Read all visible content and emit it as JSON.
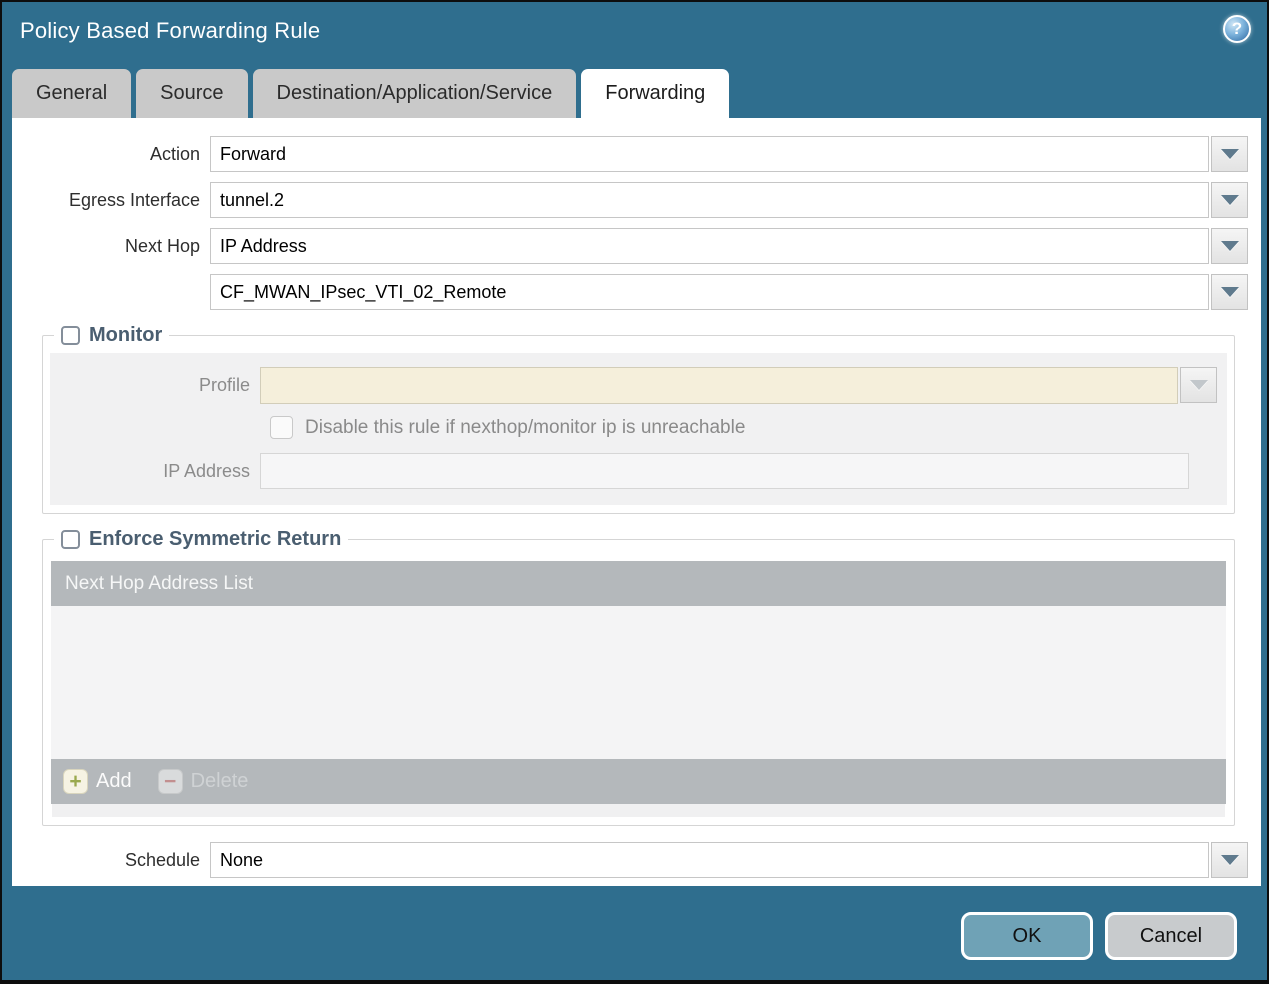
{
  "dialog": {
    "title": "Policy Based Forwarding Rule"
  },
  "tabs": [
    {
      "label": "General",
      "active": false
    },
    {
      "label": "Source",
      "active": false
    },
    {
      "label": "Destination/Application/Service",
      "active": false
    },
    {
      "label": "Forwarding",
      "active": true
    }
  ],
  "form": {
    "action": {
      "label": "Action",
      "value": "Forward"
    },
    "egress_interface": {
      "label": "Egress Interface",
      "value": "tunnel.2"
    },
    "next_hop": {
      "label": "Next Hop",
      "value": "IP Address"
    },
    "next_hop_address": {
      "value": "CF_MWAN_IPsec_VTI_02_Remote"
    },
    "schedule": {
      "label": "Schedule",
      "value": "None"
    }
  },
  "monitor": {
    "legend": "Monitor",
    "checked": false,
    "profile": {
      "label": "Profile",
      "value": ""
    },
    "disable_rule": {
      "label": "Disable this rule if nexthop/monitor ip is unreachable",
      "checked": false
    },
    "ip_address": {
      "label": "IP Address",
      "value": ""
    }
  },
  "enforce_symmetric_return": {
    "legend": "Enforce Symmetric Return",
    "checked": false,
    "table_header": "Next Hop Address List",
    "rows": [],
    "add_label": "Add",
    "delete_label": "Delete"
  },
  "footer": {
    "ok_label": "OK",
    "cancel_label": "Cancel"
  },
  "colors": {
    "titlebar": "#2f6e8e",
    "ok_button": "#6fa2b6",
    "cancel_button": "#c8cbcd",
    "table_chrome": "#b4b8bb",
    "disabled_field": "#f5efdb",
    "accent_text": "#4a5e70"
  }
}
